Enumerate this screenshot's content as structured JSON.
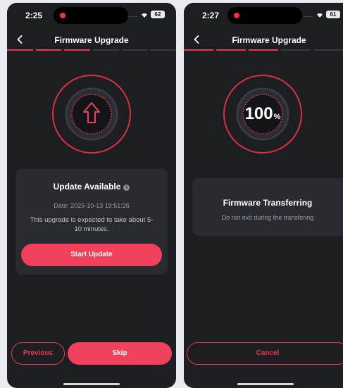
{
  "left": {
    "status": {
      "time": "2:25",
      "signal": "....",
      "battery": "62"
    },
    "nav": {
      "title": "Firmware Upgrade"
    },
    "steps": [
      true,
      true,
      true,
      false,
      false,
      false
    ],
    "card": {
      "title": "Update Available",
      "date": "Date: 2025-10-13 19:51:26",
      "description": "This upgrade is expected to take about 5-10 minutes.",
      "start_label": "Start Update"
    },
    "footer": {
      "previous_label": "Previous",
      "skip_label": "Skip"
    }
  },
  "right": {
    "status": {
      "time": "2:27",
      "signal": "....",
      "battery": "61"
    },
    "nav": {
      "title": "Firmware Upgrade"
    },
    "steps": [
      true,
      true,
      true,
      false,
      false,
      false
    ],
    "progress": {
      "value": "100",
      "unit": "%"
    },
    "card": {
      "title": "Firmware Transferring",
      "subtitle": "Do not exit during the transfering"
    },
    "footer": {
      "cancel_label": "Cancel"
    }
  },
  "colors": {
    "accent": "#e8384f",
    "background": "#1d1e22",
    "card": "#2a2b30"
  },
  "icons": [
    "chevron-left-icon",
    "upload-arrow-icon",
    "info-icon",
    "wifi-icon",
    "battery-icon"
  ]
}
